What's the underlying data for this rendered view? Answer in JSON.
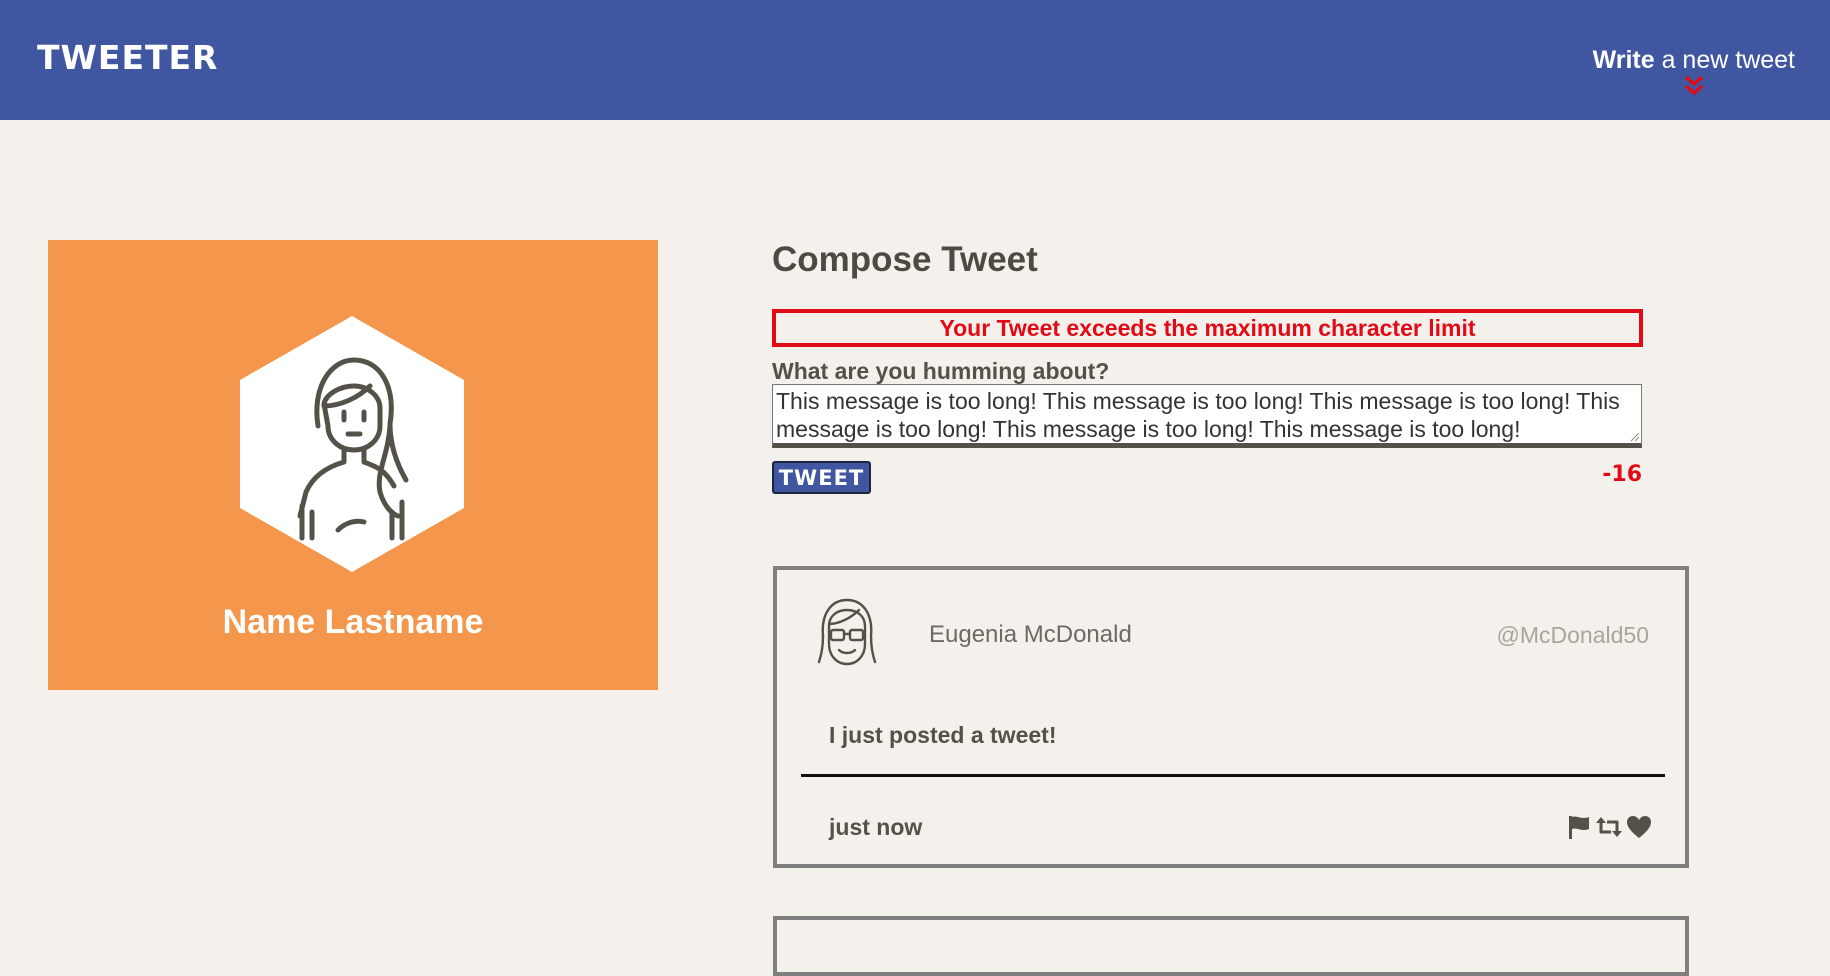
{
  "nav": {
    "brand": "TWEETER",
    "write_bold": "Write",
    "write_rest": " a new tweet",
    "chevron_icon": "double-chevron-down-icon",
    "bg_color": "#4056a1",
    "chevron_color": "#e00b16"
  },
  "profile": {
    "name": "Name Lastname",
    "bg_color": "#f4964b",
    "avatar_icon": "user-avatar-hexagon-icon"
  },
  "compose": {
    "title": "Compose Tweet",
    "error": "Your Tweet exceeds the maximum character limit",
    "label": "What are you humming about?",
    "text": "This message is too long! This message is too long! This message is too long! This message is too long! This message is too long! This message is too long!",
    "button": "TWEET",
    "counter": "-16",
    "error_color": "#e00b16"
  },
  "tweets": [
    {
      "name": "Eugenia McDonald",
      "handle": "@McDonald50",
      "content": "I just posted a tweet!",
      "time": "just now",
      "avatar_icon": "user-avatar-glasses-icon",
      "actions": [
        "flag-icon",
        "retweet-icon",
        "heart-icon"
      ]
    }
  ]
}
